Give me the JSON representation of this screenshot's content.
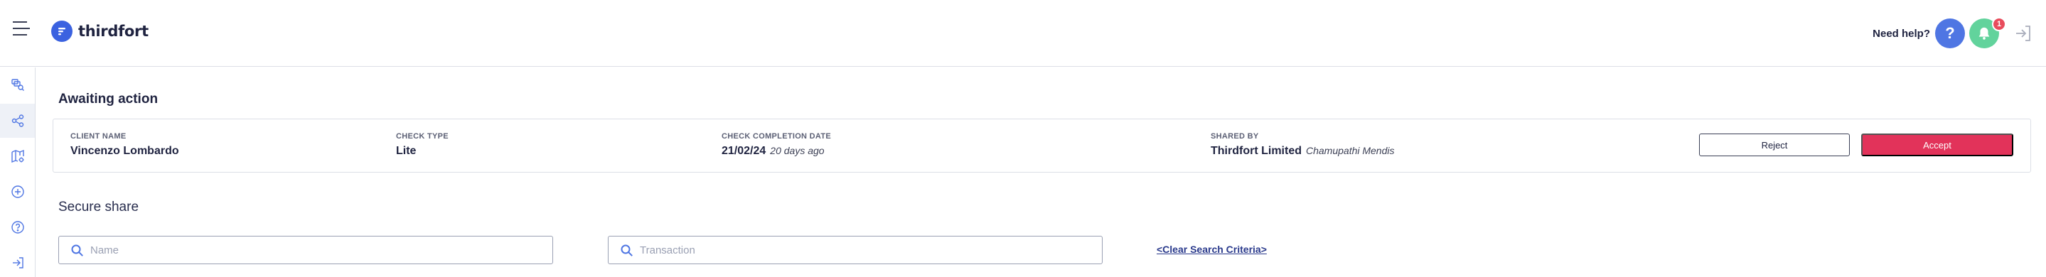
{
  "header": {
    "brand": "thirdfort",
    "help_text": "Need help?",
    "help_icon": "?",
    "notification_count": "1"
  },
  "sidebar": {
    "items": [
      {
        "icon": "search-documents-icon"
      },
      {
        "icon": "share-icon",
        "active": true
      },
      {
        "icon": "map-settings-icon"
      },
      {
        "icon": "plus-circle-icon"
      },
      {
        "icon": "help-circle-icon"
      },
      {
        "icon": "logout-icon"
      }
    ]
  },
  "awaiting": {
    "title": "Awaiting action",
    "client_label": "CLIENT NAME",
    "client_value": "Vincenzo Lombardo",
    "check_type_label": "CHECK TYPE",
    "check_type_value": "Lite",
    "completion_label": "CHECK COMPLETION DATE",
    "completion_date": "21/02/24",
    "completion_ago": "20 days ago",
    "shared_label": "SHARED BY",
    "shared_company": "Thirdfort Limited",
    "shared_person": "Chamupathi Mendis",
    "reject_label": "Reject",
    "accept_label": "Accept"
  },
  "secure_share": {
    "title": "Secure share",
    "name_placeholder": "Name",
    "transaction_placeholder": "Transaction",
    "clear_label": "<Clear Search Criteria>"
  },
  "colors": {
    "brand_blue": "#3b62e0",
    "accept_red": "#e2335a",
    "bell_green": "#62d39c",
    "badge_red": "#e84c5c"
  }
}
